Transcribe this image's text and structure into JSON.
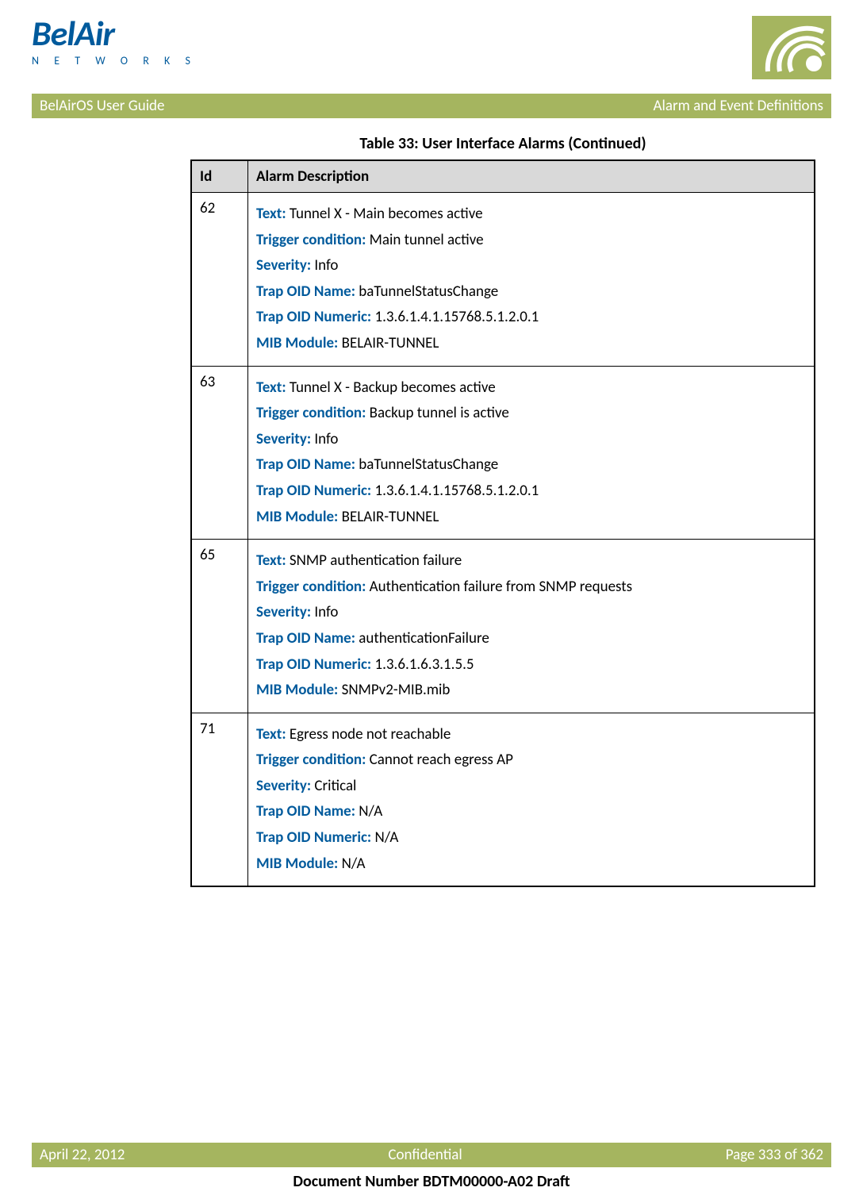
{
  "logo": {
    "brand": "BelAir",
    "subtitle": "N E T W O R K S"
  },
  "header_bar": {
    "left": "BelAirOS User Guide",
    "right": "Alarm and Event Definitions"
  },
  "table": {
    "title": "Table 33: User Interface Alarms  (Continued)",
    "headers": {
      "id": "Id",
      "desc": "Alarm Description"
    },
    "field_labels": {
      "text": "Text:",
      "trigger": "Trigger condition:",
      "severity": "Severity:",
      "trap_name": "Trap OID Name:",
      "trap_num": "Trap OID Numeric:",
      "mib": "MIB Module:"
    },
    "rows": [
      {
        "id": "62",
        "text": "Tunnel X - Main becomes active",
        "trigger": "Main tunnel active",
        "severity": "Info",
        "trap_name": "baTunnelStatusChange",
        "trap_num": "1.3.6.1.4.1.15768.5.1.2.0.1",
        "mib": "BELAIR-TUNNEL"
      },
      {
        "id": "63",
        "text": "Tunnel X - Backup becomes active",
        "trigger": "Backup tunnel is active",
        "severity": "Info",
        "trap_name": "baTunnelStatusChange",
        "trap_num": "1.3.6.1.4.1.15768.5.1.2.0.1",
        "mib": "BELAIR-TUNNEL"
      },
      {
        "id": "65",
        "text": "SNMP authentication failure",
        "trigger": "Authentication failure from SNMP requests",
        "severity": "Info",
        "trap_name": "authenticationFailure",
        "trap_num": "1.3.6.1.6.3.1.5.5",
        "mib": "SNMPv2-MIB.mib"
      },
      {
        "id": "71",
        "text": "Egress node not reachable",
        "trigger": "Cannot reach egress AP",
        "severity": "Critical",
        "trap_name": "N/A",
        "trap_num": "N/A",
        "mib": "N/A"
      }
    ]
  },
  "footer": {
    "date": "April 22, 2012",
    "center": "Confidential",
    "page": "Page 333 of 362",
    "docnum": "Document Number BDTM00000-A02 Draft"
  }
}
